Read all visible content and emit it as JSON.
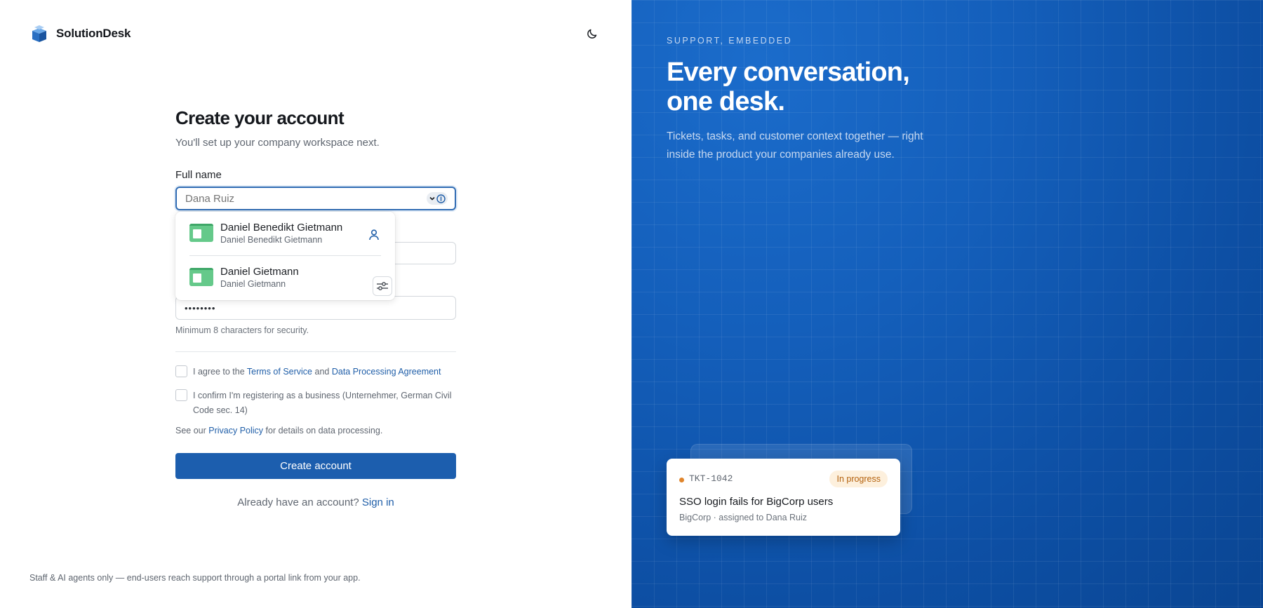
{
  "brand": {
    "name": "SolutionDesk",
    "logo_icon": "stacked-box-logo-icon"
  },
  "theme_toggle": {
    "icon": "moon-icon"
  },
  "form": {
    "title": "Create your account",
    "subtitle": "You'll set up your company workspace next.",
    "full_name": {
      "label": "Full name",
      "placeholder": "Dana Ruiz"
    },
    "password": {
      "value": "••••••••",
      "hint": "Minimum 8 characters for security."
    },
    "terms": {
      "prefix": "I agree to the",
      "terms_link": "Terms of Service",
      "and": "and",
      "dpa_link": "Data Processing Agreement"
    },
    "business_confirm": "I confirm I'm registering as a business (Unternehmer, German Civil Code sec. 14)",
    "privacy": {
      "prefix": "See our",
      "link": "Privacy Policy",
      "suffix": "for details on data processing."
    },
    "submit_label": "Create account",
    "signin": {
      "prompt": "Already have an account?",
      "link": "Sign in"
    }
  },
  "autofill": {
    "items": [
      {
        "main": "Daniel Benedikt Gietmann",
        "sub": "Daniel Benedikt Gietmann"
      },
      {
        "main": "Daniel Gietmann",
        "sub": "Daniel Gietmann"
      }
    ]
  },
  "footer_note": "Staff & AI agents only — end-users reach support through a portal link from your app.",
  "hero": {
    "eyebrow": "SUPPORT, EMBEDDED",
    "headline": "Every conversation, one desk.",
    "subtext": "Tickets, tasks, and customer context together — right inside the product your companies already use."
  },
  "ticket_card": {
    "id": "TKT-1042",
    "status": "In progress",
    "status_color": "#b4620e",
    "title": "SSO login fails for BigCorp users",
    "meta": "BigCorp · assigned to Dana Ruiz"
  },
  "colors": {
    "accent": "#1c5eae",
    "link": "#1f5ea8",
    "panel": "#145fbb"
  }
}
